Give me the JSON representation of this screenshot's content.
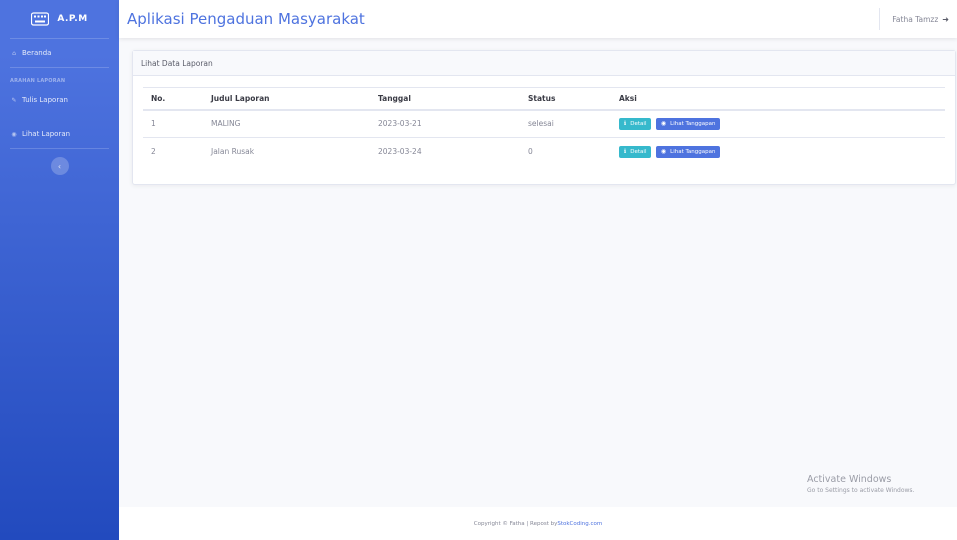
{
  "sidebar": {
    "brand": "A.P.M",
    "items": [
      {
        "label": "Beranda",
        "icon": "home-icon"
      },
      {
        "label": "Tulis Laporan",
        "icon": "edit-icon"
      },
      {
        "label": "Lihat Laporan",
        "icon": "eye-icon"
      }
    ],
    "heading": "ARAHAN LAPORAN"
  },
  "topbar": {
    "title": "Aplikasi Pengaduan Masyarakat",
    "user_name": "Fatha Tamzz"
  },
  "card": {
    "title": "Lihat Data Laporan",
    "columns": [
      "No.",
      "Judul Laporan",
      "Tanggal",
      "Status",
      "Aksi"
    ],
    "rows": [
      {
        "no": "1",
        "judul": "MALING",
        "tanggal": "2023-03-21",
        "status": "selesai"
      },
      {
        "no": "2",
        "judul": "Jalan Rusak",
        "tanggal": "2023-03-24",
        "status": "0"
      }
    ],
    "detail_label": "Detail",
    "tanggapan_label": "Lihat Tanggapan"
  },
  "watermark": {
    "title": "Activate Windows",
    "subtitle": "Go to Settings to activate Windows."
  },
  "footer": {
    "text": "Copyright © Fatha | Repost by ",
    "link": "StokCoding.com"
  },
  "colors": {
    "primary": "#4e73df",
    "info": "#36b9cc",
    "sidebar_dark": "#224abe"
  }
}
